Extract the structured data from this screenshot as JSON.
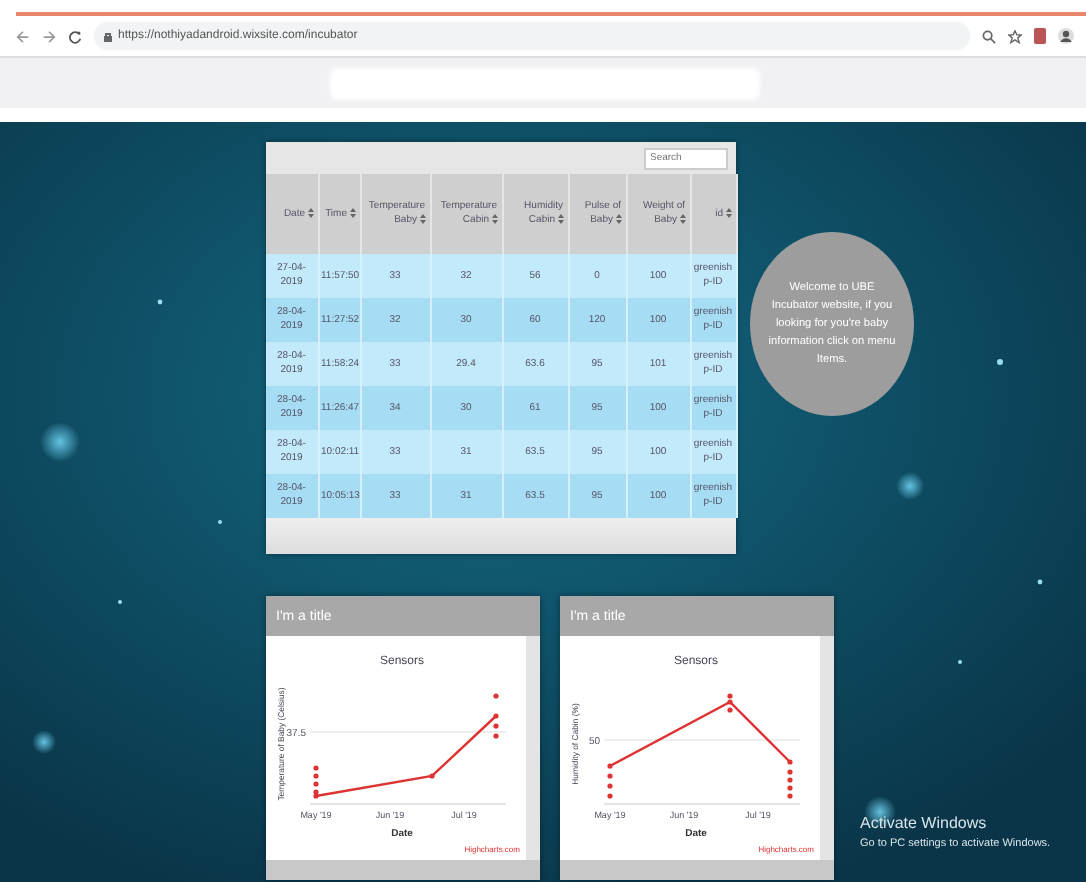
{
  "browser": {
    "url": "https://nothiyadandroid.wixsite.com/incubator"
  },
  "table": {
    "search": {
      "placeholder": "Search"
    },
    "columns": [
      "Date",
      "Time",
      "Temperature Baby",
      "Temperature Cabin",
      "Humidity Cabin",
      "Pulse of Baby",
      "Weight of Baby",
      "id"
    ],
    "rows": [
      [
        "27-04-2019",
        "11:57:50",
        "33",
        "32",
        "56",
        "0",
        "100",
        "greenish p-ID"
      ],
      [
        "28-04-2019",
        "11:27:52",
        "32",
        "30",
        "60",
        "120",
        "100",
        "greenish p-ID"
      ],
      [
        "28-04-2019",
        "11:58:24",
        "33",
        "29.4",
        "63.6",
        "95",
        "101",
        "greenish p-ID"
      ],
      [
        "28-04-2019",
        "11:26:47",
        "34",
        "30",
        "61",
        "95",
        "100",
        "greenish p-ID"
      ],
      [
        "28-04-2019",
        "10:02:11",
        "33",
        "31",
        "63.5",
        "95",
        "100",
        "greenish p-ID"
      ],
      [
        "28-04-2019",
        "10:05:13",
        "33",
        "31",
        "63.5",
        "95",
        "100",
        "greenish p-ID"
      ]
    ]
  },
  "welcome": {
    "text": "Welcome to UBE Incubator website, if you looking for you're baby information click on menu Items."
  },
  "charts": [
    {
      "title": "I'm a title",
      "chart_title": "Sensors",
      "ylabel": "Temperature of Baby (Celsius)",
      "ytick": "37.5",
      "xticks": [
        "May '19",
        "Jun '19",
        "Jul '19"
      ],
      "xlabel": "Date",
      "credit": "Highcharts.com"
    },
    {
      "title": "I'm a title",
      "chart_title": "Sensors",
      "ylabel": "Humidity of Cabin (%)",
      "ytick": "50",
      "xticks": [
        "May '19",
        "Jun '19",
        "Jul '19"
      ],
      "xlabel": "Date",
      "credit": "Highcharts.com"
    }
  ],
  "watermark": {
    "title": "Activate Windows",
    "subtitle": "Go to PC settings to activate Windows."
  }
}
